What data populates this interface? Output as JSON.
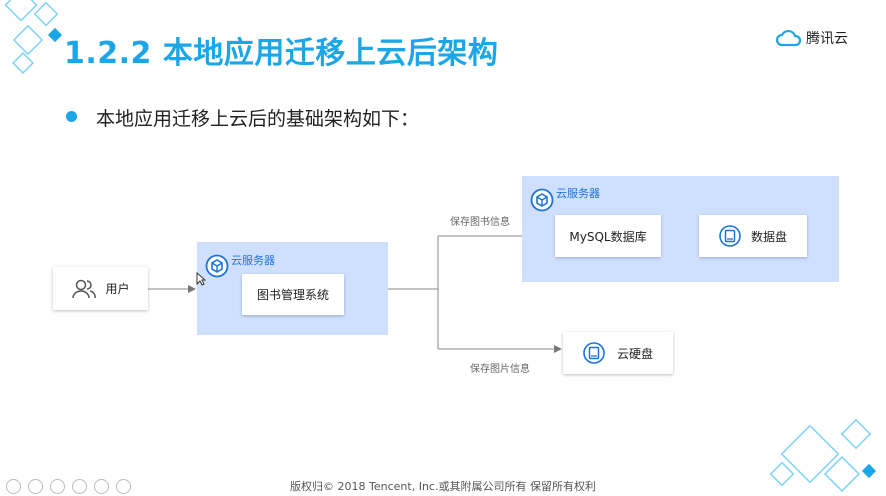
{
  "slide": {
    "title": "1.2.2 本地应用迁移上云后架构",
    "brand": {
      "name": "腾讯云",
      "icon": "tencent-cloud-icon"
    },
    "bullet": "本地应用迁移上云后的基础架构如下："
  },
  "diagram": {
    "user": {
      "label": "用户",
      "icon": "user-group-icon"
    },
    "zone_left": {
      "label": "云服务器",
      "icon": "cloud-server-icon",
      "app": "图书管理系统"
    },
    "zone_right": {
      "label": "云服务器",
      "icon": "cloud-server-icon",
      "db": "MySQL数据库",
      "disk": "数据盘",
      "disk_icon": "disk-icon"
    },
    "cloud_disk": {
      "label": "云硬盘",
      "icon": "disk-icon"
    },
    "edges": {
      "upper": "保存图书信息",
      "lower": "保存图片信息"
    }
  },
  "footer": "版权归© 2018 Tencent, Inc.或其附属公司所有 保留所有权利",
  "colors": {
    "accent": "#1ba6e8",
    "zone": "#cfe0ff",
    "zone_label": "#1e73d8"
  }
}
